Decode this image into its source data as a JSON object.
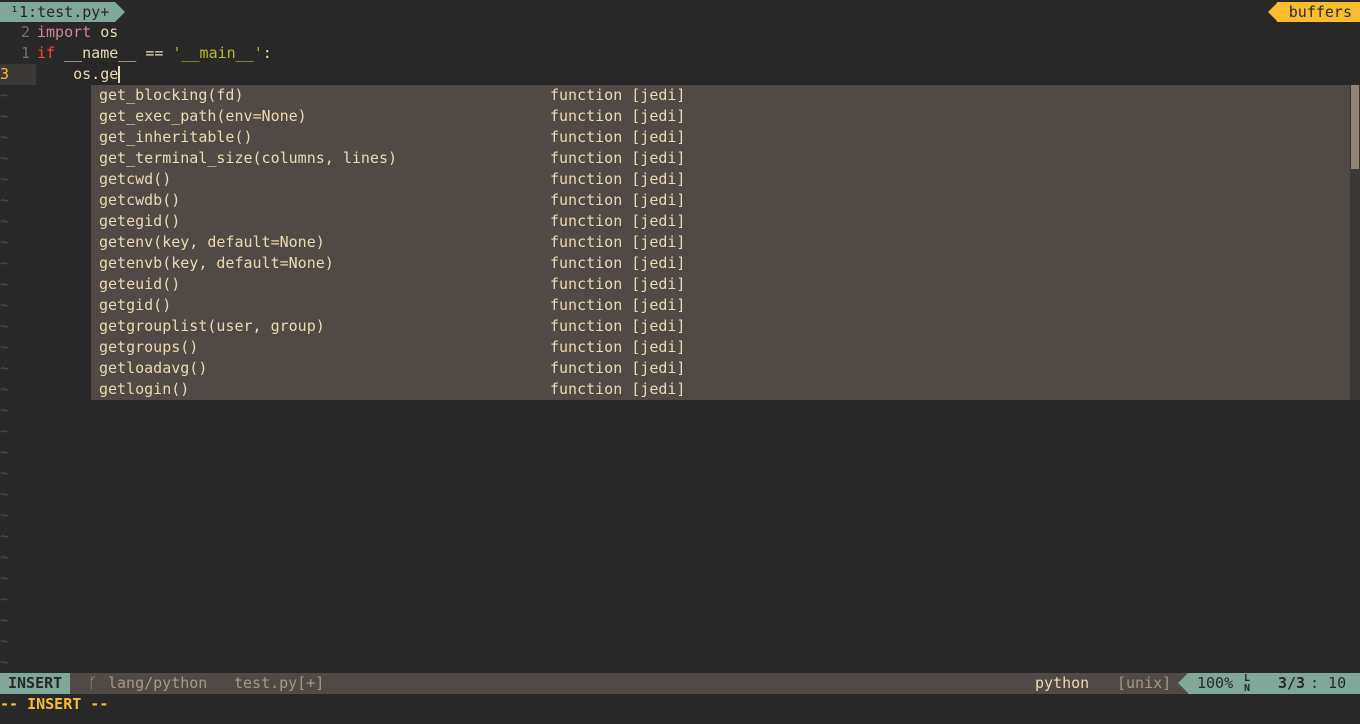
{
  "tabline": {
    "tab_label": "¹1:test.py+",
    "buffers_label": "buffers"
  },
  "editor": {
    "lines": [
      {
        "number": "2",
        "tokens": [
          {
            "text": "import",
            "kind": "kw2"
          },
          {
            "text": " os",
            "kind": "plain"
          }
        ]
      },
      {
        "number": "1",
        "tokens": [
          {
            "text": "if",
            "kind": "kw"
          },
          {
            "text": " __name__ == ",
            "kind": "plain"
          },
          {
            "text": "'__main__'",
            "kind": "str"
          },
          {
            "text": ":",
            "kind": "plain"
          }
        ]
      },
      {
        "number": "3",
        "tokens": [
          {
            "text": "    os.ge",
            "kind": "plain"
          }
        ]
      }
    ],
    "tilde": "~"
  },
  "completion_menu": {
    "items": [
      {
        "word": "get_blocking(fd)",
        "kind": "function [jedi]"
      },
      {
        "word": "get_exec_path(env=None)",
        "kind": "function [jedi]"
      },
      {
        "word": "get_inheritable()",
        "kind": "function [jedi]"
      },
      {
        "word": "get_terminal_size(columns, lines)",
        "kind": "function [jedi]"
      },
      {
        "word": "getcwd()",
        "kind": "function [jedi]"
      },
      {
        "word": "getcwdb()",
        "kind": "function [jedi]"
      },
      {
        "word": "getegid()",
        "kind": "function [jedi]"
      },
      {
        "word": "getenv(key, default=None)",
        "kind": "function [jedi]"
      },
      {
        "word": "getenvb(key, default=None)",
        "kind": "function [jedi]"
      },
      {
        "word": "geteuid()",
        "kind": "function [jedi]"
      },
      {
        "word": "getgid()",
        "kind": "function [jedi]"
      },
      {
        "word": "getgrouplist(user, group)",
        "kind": "function [jedi]"
      },
      {
        "word": "getgroups()",
        "kind": "function [jedi]"
      },
      {
        "word": "getloadavg()",
        "kind": "function [jedi]"
      },
      {
        "word": "getlogin()",
        "kind": "function [jedi]"
      }
    ]
  },
  "statusline": {
    "mode": "INSERT",
    "branch_icon": "ᚴ",
    "path": "lang/python",
    "file": "test.py[+]",
    "filetype": "python",
    "fileformat": "[unix]",
    "percent": "100%",
    "ln_icon_top": "L",
    "ln_icon_bottom": "N",
    "position": "3/3",
    "column": ": 10"
  },
  "cmdline": {
    "text": "-- INSERT --"
  },
  "colors": {
    "background": "#282828",
    "accent": "#7fa898",
    "yellow": "#fabd2f",
    "menu_bg": "#504945"
  }
}
